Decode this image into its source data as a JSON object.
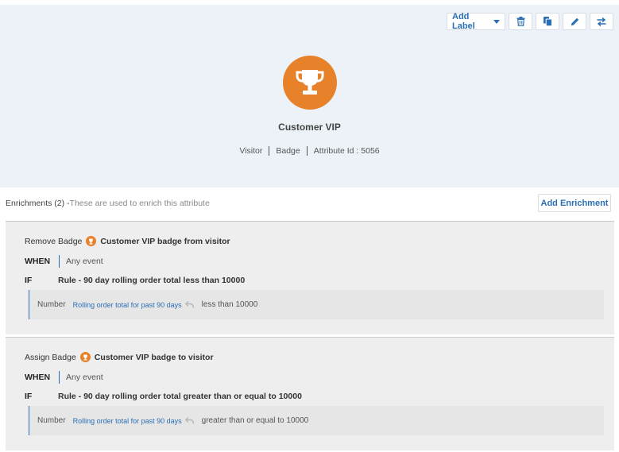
{
  "toolbar": {
    "add_label": "Add Label",
    "buttons": [
      "trash-icon",
      "copy-icon",
      "pencil-icon",
      "swap-icon"
    ]
  },
  "attribute": {
    "name": "Customer VIP",
    "icon": "trophy-icon",
    "type": "Visitor",
    "kind": "Badge",
    "id_text": "Attribute Id : 5056"
  },
  "enrichments": {
    "header": "Enrichments (2) -",
    "subtitle": "These are used to enrich this attribute",
    "add_button": "Add Enrichment",
    "items": [
      {
        "action": "Remove Badge",
        "target": "Customer VIP badge from visitor",
        "when_kw": "WHEN",
        "when_val": "Any event",
        "if_kw": "IF",
        "if_val": "Rule - 90 day rolling order total less than 10000",
        "cond_type": "Number",
        "cond_attr": "Rolling order total for past 90 days",
        "cond_op": "less than 10000"
      },
      {
        "action": "Assign Badge",
        "target": "Customer VIP badge to visitor",
        "when_kw": "WHEN",
        "when_val": "Any event",
        "if_kw": "IF",
        "if_val": "Rule - 90 day rolling order total greater than or equal to 10000",
        "cond_type": "Number",
        "cond_attr": "Rolling order total for past 90 days",
        "cond_op": "greater than or equal to 10000"
      }
    ]
  },
  "colors": {
    "accent": "#2a6fb5",
    "badge": "#e8822a",
    "panel": "#edf2f8",
    "card": "#eeeeee"
  }
}
